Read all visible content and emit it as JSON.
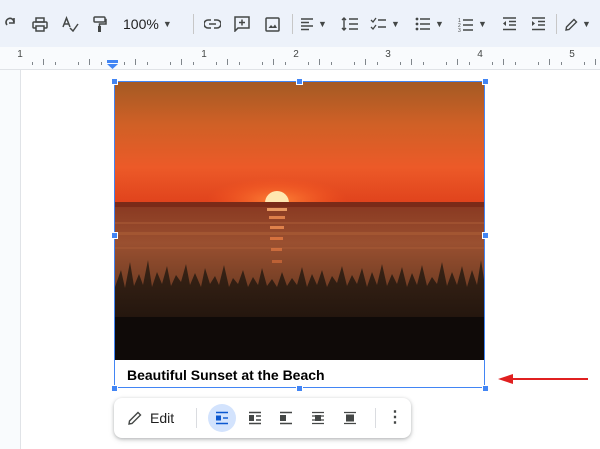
{
  "toolbar": {
    "zoom_value": "100%",
    "icons": [
      "redo-icon",
      "print-icon",
      "spellcheck-icon",
      "paint-format-icon",
      "zoom-dropdown",
      "link-icon",
      "add-comment-icon",
      "insert-image-icon",
      "align-icon",
      "line-spacing-icon",
      "checklist-icon",
      "bulleted-list-icon",
      "numbered-list-icon",
      "decrease-indent-icon",
      "increase-indent-icon",
      "editing-mode-icon"
    ]
  },
  "ruler": {
    "numbers": [
      "1",
      "1",
      "2",
      "3",
      "4",
      "5"
    ]
  },
  "image": {
    "caption": "Beautiful Sunset at the Beach",
    "colors": {
      "sky_top": "#b45a1c",
      "sky_mid": "#e45a26",
      "horizon": "#d2431b",
      "sun": "#ffe7b0",
      "water": "#7a3e23",
      "grass": "#1e1410"
    }
  },
  "image_options_bar": {
    "edit_label": "Edit",
    "wrap_options": [
      "in-line",
      "wrap-text",
      "break-text",
      "behind-text",
      "in-front-of-text"
    ],
    "selected_wrap": "in-line"
  },
  "annotation": {
    "arrow_color": "#e02020"
  },
  "colors": {
    "toolbar_bg": "#edf2fa",
    "selection": "#4285f4",
    "active_chip": "#d3e3fd"
  }
}
